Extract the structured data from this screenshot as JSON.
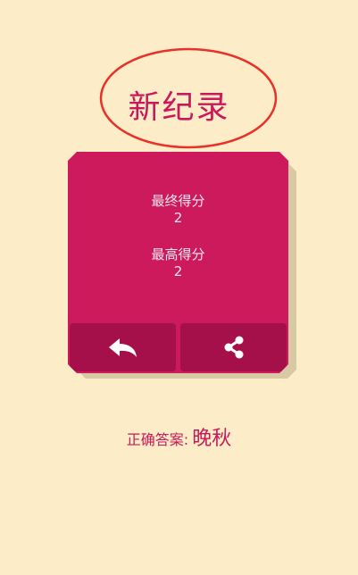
{
  "title": "新纪录",
  "stats": [
    {
      "label": "最终得分",
      "value": "2"
    },
    {
      "label": "最高得分",
      "value": "2"
    }
  ],
  "buttons": {
    "back_icon": "reply-arrow-icon",
    "share_icon": "share-icon"
  },
  "answer": {
    "label": "正确答案:",
    "value": "晚秋"
  },
  "colors": {
    "background": "#fcecc8",
    "accent": "#cd1a5d",
    "button": "#a6104a",
    "annotation": "#e8312a"
  }
}
